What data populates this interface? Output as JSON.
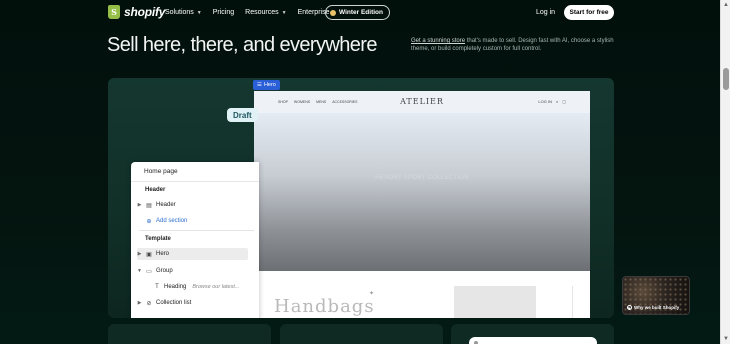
{
  "nav": {
    "logo_glyph": "S",
    "logo_text": "shopify",
    "links": [
      {
        "label": "Solutions",
        "has_dropdown": true
      },
      {
        "label": "Pricing",
        "has_dropdown": false
      },
      {
        "label": "Resources",
        "has_dropdown": true
      },
      {
        "label": "Enterprise",
        "has_dropdown": false
      }
    ],
    "edition_label": "Winter Edition",
    "login_label": "Log in",
    "cta_label": "Start for free"
  },
  "hero": {
    "headline": "Sell here, there, and everywhere",
    "description_link": "Get a stunning store",
    "description_rest": " that's made to sell. Design fast with AI, choose a stylish theme, or build completely custom for full control."
  },
  "editor": {
    "hero_tag": "Hero",
    "draft_label": "Draft",
    "sidebar": {
      "title": "Home page",
      "header_section": "Header",
      "header_item": "Header",
      "add_section": "Add section",
      "template_section": "Template",
      "hero_item": "Hero",
      "group_item": "Group",
      "heading_item": "Heading",
      "heading_hint": "Browse our latest...",
      "collection_item": "Collection list"
    },
    "preview": {
      "menu": [
        "SHOP",
        "WOMENS",
        "MENS",
        "ACCESSORIES"
      ],
      "brand": "ATELIER",
      "account": "LOG IN",
      "hero_text": "RESORT SPORT COLLECTION",
      "script_text": "Handbags"
    }
  },
  "video": {
    "label": "Why we built Shopify"
  },
  "colors": {
    "background": "#04140f",
    "card": "#113028",
    "accent_blue": "#2a5fd8",
    "brand_green": "#95bf47"
  }
}
